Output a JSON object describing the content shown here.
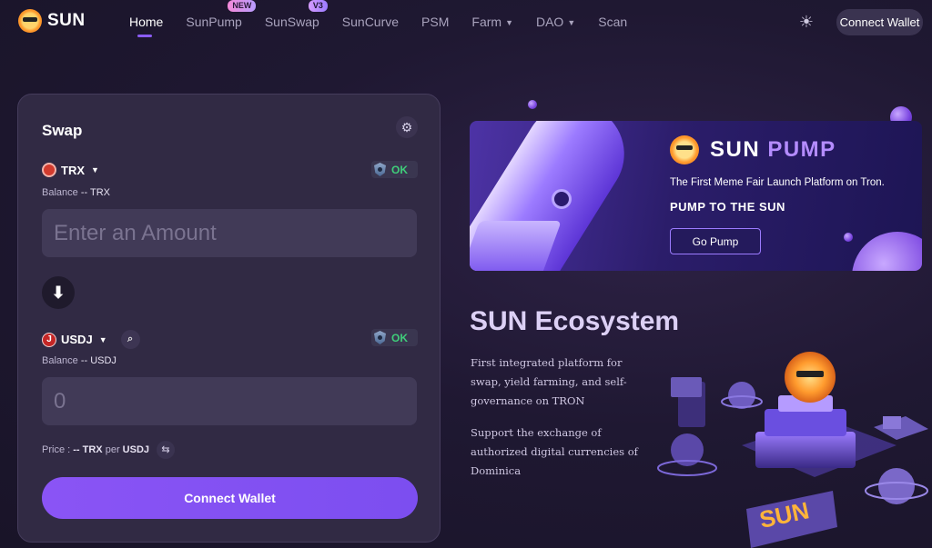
{
  "header": {
    "logo_text": "SUN",
    "nav": [
      {
        "label": "Home",
        "active": true
      },
      {
        "label": "SunPump",
        "badge": "NEW"
      },
      {
        "label": "SunSwap",
        "badge": "V3"
      },
      {
        "label": "SunCurve"
      },
      {
        "label": "PSM"
      },
      {
        "label": "Farm",
        "dropdown": true
      },
      {
        "label": "DAO",
        "dropdown": true
      },
      {
        "label": "Scan"
      }
    ],
    "theme_icon": "sun-icon",
    "connect_label": "Connect Wallet"
  },
  "swap": {
    "title": "Swap",
    "settings_icon": "gear-icon",
    "from": {
      "token": "TRX",
      "status": "OK",
      "balance_label": "Balance",
      "balance_value": "-- TRX",
      "placeholder": "Enter an Amount"
    },
    "to": {
      "token": "USDJ",
      "token_icon_letter": "J",
      "status": "OK",
      "balance_label": "Balance",
      "balance_value": "-- USDJ",
      "value": "0"
    },
    "price": {
      "label": "Price :",
      "value": "-- TRX",
      "per": "per",
      "quote": "USDJ"
    },
    "connect_label": "Connect Wallet"
  },
  "banner": {
    "brand_main": "SUN",
    "brand_accent": "PUMP",
    "subtitle": "The First Meme Fair Launch Platform on Tron.",
    "slogan": "PUMP TO THE SUN",
    "button_label": "Go Pump"
  },
  "ecosystem": {
    "title": "SUN Ecosystem",
    "paragraph1": "First integrated platform for swap, yield farming, and self-governance on TRON",
    "paragraph2": "Support the exchange of authorized digital currencies of Dominica",
    "art_label": "SUN"
  },
  "colors": {
    "accent": "#8b5cf6",
    "ok_green": "#3fce7a",
    "background": "#1f1832"
  }
}
